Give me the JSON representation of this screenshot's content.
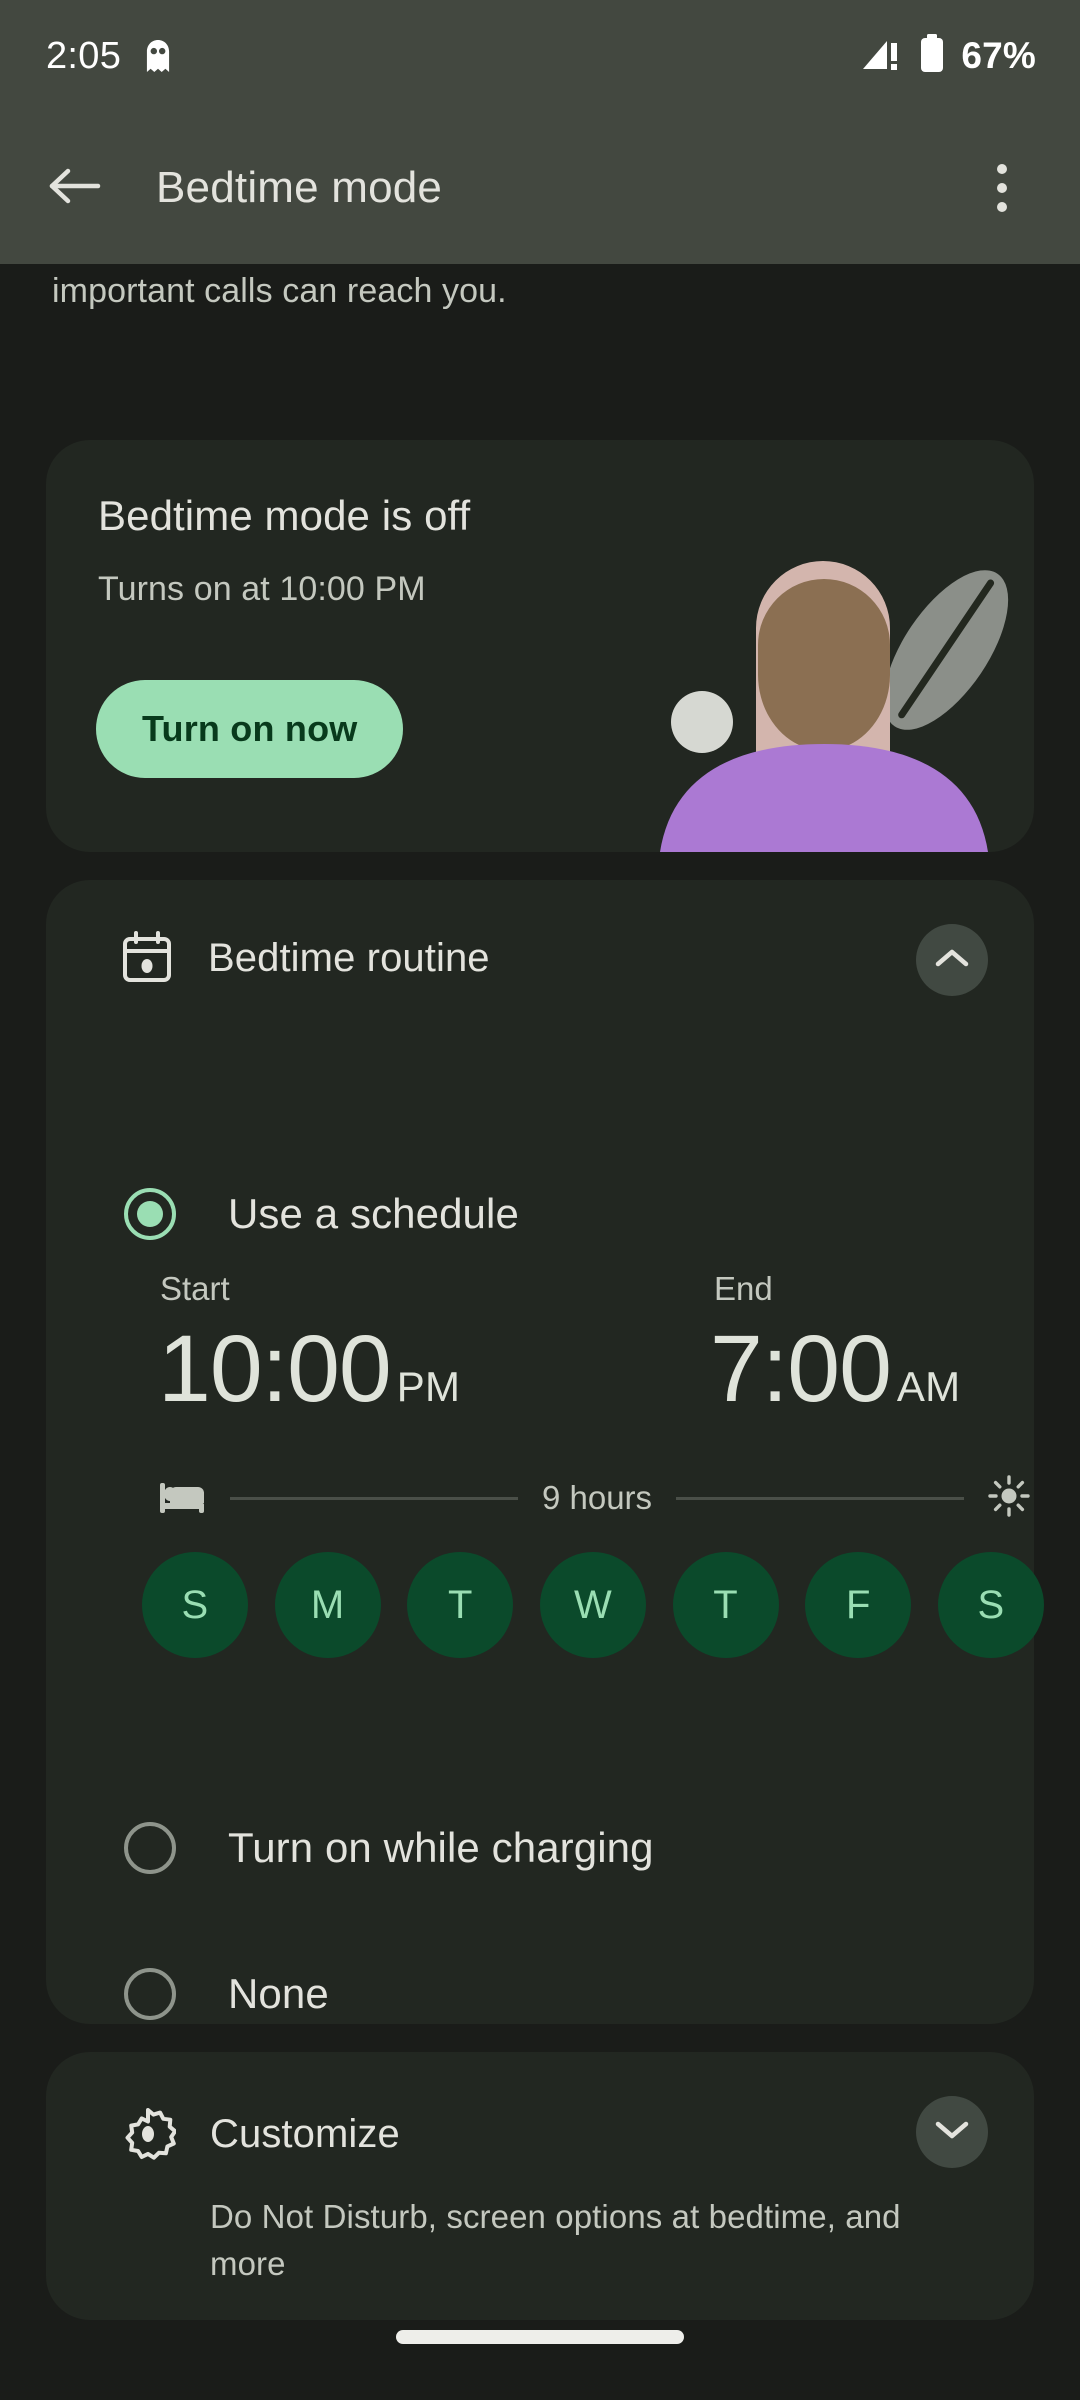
{
  "status_bar": {
    "time": "2:05",
    "notification_icon": "ghost-icon",
    "signal_icon": "signal-no-service-icon",
    "battery_icon": "battery-icon",
    "battery_percent": "67%"
  },
  "app_bar": {
    "back_icon": "back-arrow-icon",
    "title": "Bedtime mode",
    "overflow_icon": "more-vert-icon"
  },
  "scrolled_text": "important calls can reach you.",
  "status_card": {
    "title": "Bedtime mode is off",
    "subtitle": "Turns on at 10:00 PM",
    "button_label": "Turn on now",
    "illustration": "person-sleeping-illustration",
    "button_bg": "#9adeb3",
    "button_fg": "#083a1c"
  },
  "routine_card": {
    "icon": "calendar-schedule-icon",
    "title": "Bedtime routine",
    "expand_icon": "chevron-up-icon",
    "expanded": true,
    "options": [
      {
        "label": "Use a schedule",
        "selected": true
      },
      {
        "label": "Turn on while charging",
        "selected": false
      },
      {
        "label": "None",
        "selected": false
      }
    ],
    "schedule": {
      "start_label": "Start",
      "end_label": "End",
      "start_time": "10:00",
      "start_meridiem": "PM",
      "end_time": "7:00",
      "end_meridiem": "AM",
      "duration": "9 hours",
      "bed_icon": "bed-icon",
      "sun_icon": "sun-icon",
      "days": [
        {
          "label": "S",
          "selected": true
        },
        {
          "label": "M",
          "selected": true
        },
        {
          "label": "T",
          "selected": true
        },
        {
          "label": "W",
          "selected": true
        },
        {
          "label": "T",
          "selected": true
        },
        {
          "label": "F",
          "selected": true
        },
        {
          "label": "S",
          "selected": true
        }
      ],
      "day_selected_bg": "#0b4a2b",
      "day_selected_fg": "#9adeb3"
    }
  },
  "customize_card": {
    "icon": "gear-icon",
    "title": "Customize",
    "subtitle": "Do Not Disturb, screen options at bedtime, and more",
    "expand_icon": "chevron-down-icon"
  },
  "theme": {
    "page_bg": "#1a1c19",
    "card_bg": "#222721",
    "bar_bg": "#434840",
    "accent": "#9adeb3",
    "text_primary": "#e3e3dd",
    "text_secondary": "#c4c8bf"
  }
}
